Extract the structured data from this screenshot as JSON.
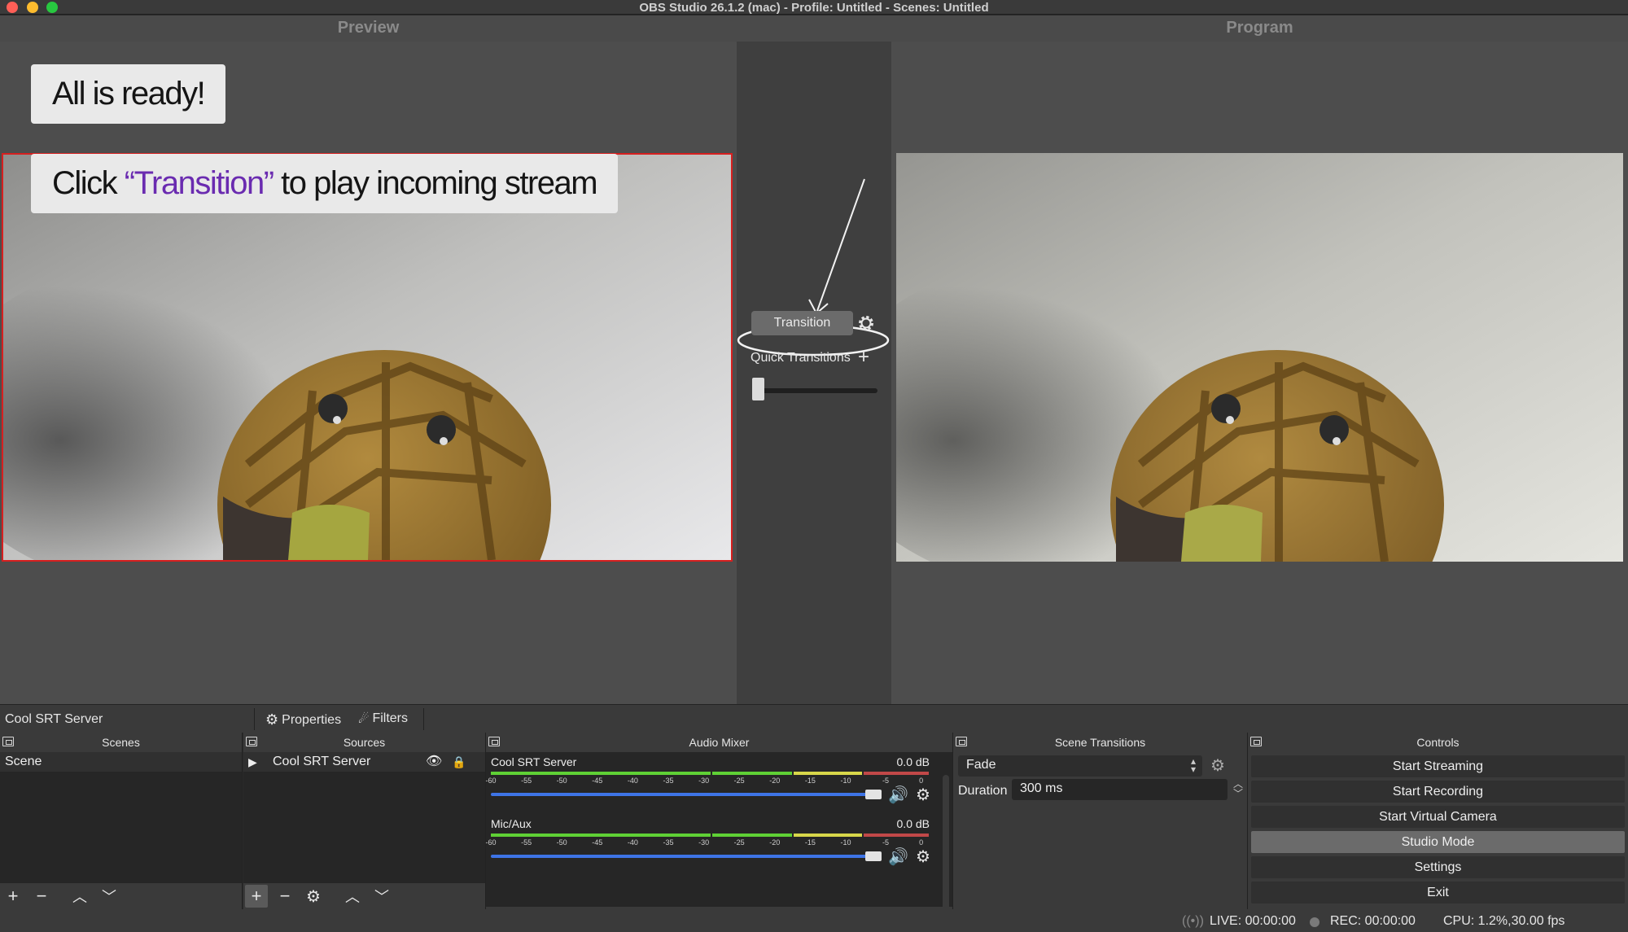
{
  "window": {
    "title": "OBS Studio 26.1.2 (mac) - Profile: Untitled - Scenes: Untitled"
  },
  "studio": {
    "preview_label": "Preview",
    "program_label": "Program"
  },
  "annotations": {
    "ready_text": "All is ready!",
    "click_prefix": "Click ",
    "click_highlight": "“Transition”",
    "click_suffix": " to play incoming stream",
    "highlight_color": "#6a2bb0"
  },
  "transition": {
    "button_label": "Transition",
    "quick_transitions_label": "Quick Transitions",
    "tbar_position": 0
  },
  "source_toolbar": {
    "selected_source": "Cool SRT Server",
    "properties_label": "Properties",
    "filters_label": "Filters"
  },
  "scenes": {
    "title": "Scenes",
    "items": [
      "Scene"
    ]
  },
  "sources": {
    "title": "Sources",
    "items": [
      {
        "name": "Cool SRT Server",
        "visible": true,
        "locked": false
      }
    ]
  },
  "audio_mixer": {
    "title": "Audio Mixer",
    "ticks": [
      "-60",
      "-55",
      "-50",
      "-45",
      "-40",
      "-35",
      "-30",
      "-25",
      "-20",
      "-15",
      "-10",
      "-5",
      "0"
    ],
    "channels": [
      {
        "name": "Cool SRT Server",
        "db": "0.0 dB",
        "volume": 1.0
      },
      {
        "name": "Mic/Aux",
        "db": "0.0 dB",
        "volume": 1.0
      }
    ]
  },
  "scene_transitions": {
    "title": "Scene Transitions",
    "selected": "Fade",
    "duration_label": "Duration",
    "duration_value": "300 ms"
  },
  "controls": {
    "title": "Controls",
    "buttons": [
      "Start Streaming",
      "Start Recording",
      "Start Virtual Camera",
      "Studio Mode",
      "Settings",
      "Exit"
    ],
    "active": "Studio Mode"
  },
  "status": {
    "live": "LIVE: 00:00:00",
    "rec": "REC: 00:00:00",
    "cpu": "CPU: 1.2%,30.00 fps"
  },
  "colors": {
    "preview_border": "#d61f1f",
    "meter_green": "#5fd135",
    "volume_blue": "#3e74e6"
  }
}
